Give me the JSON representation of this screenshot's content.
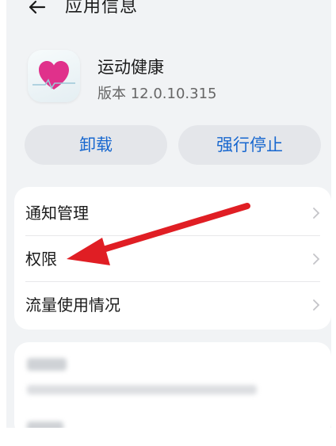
{
  "header": {
    "back_icon": "arrow-left-icon",
    "title": "应用信息"
  },
  "app": {
    "icon": "heart-health-icon",
    "name": "运动健康",
    "version": "版本 12.0.10.315"
  },
  "actions": {
    "uninstall_label": "卸载",
    "force_stop_label": "强行停止"
  },
  "settings": {
    "items": [
      {
        "label": "通知管理"
      },
      {
        "label": "权限"
      },
      {
        "label": "流量使用情况"
      }
    ]
  },
  "annotation": {
    "arrow_color": "#e01e24"
  },
  "colors": {
    "accent": "#1767cf",
    "background": "#f1f3f5"
  }
}
